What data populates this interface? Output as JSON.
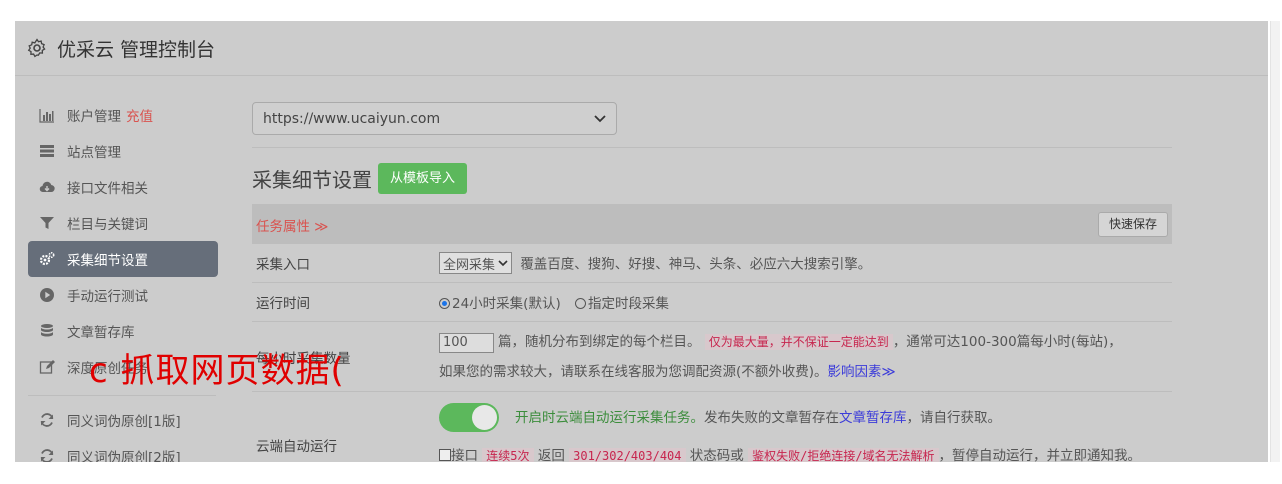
{
  "header": {
    "title": "优采云 管理控制台",
    "icon": "gear-icon"
  },
  "sidebar": {
    "items": [
      {
        "label": "账户管理",
        "extra": "充值",
        "icon": "bar-chart-icon"
      },
      {
        "label": "站点管理",
        "icon": "server-icon"
      },
      {
        "label": "接口文件相关",
        "icon": "cloud-download-icon"
      },
      {
        "label": "栏目与关键词",
        "icon": "filter-icon"
      },
      {
        "label": "采集细节设置",
        "icon": "cogs-icon",
        "active": true
      },
      {
        "label": "手动运行测试",
        "icon": "play-circle-icon"
      },
      {
        "label": "文章暂存库",
        "icon": "database-icon"
      },
      {
        "label": "深度原创任务",
        "icon": "edit-icon"
      },
      {
        "label": "同义词伪原创[1版]",
        "icon": "refresh-icon"
      },
      {
        "label": "同义词伪原创[2版]",
        "icon": "refresh-icon"
      }
    ]
  },
  "main": {
    "site_select": "https://www.ucaiyun.com",
    "section_title": "采集细节设置",
    "import_button": "从模板导入",
    "task_header": {
      "label": "任务属性 ≫",
      "save_button": "快速保存"
    },
    "rows": {
      "entry": {
        "label": "采集入口",
        "select": "全网采集",
        "desc": "覆盖百度、搜狗、好搜、神马、头条、必应六大搜索引擎。"
      },
      "time": {
        "label": "运行时间",
        "opt1": "24小时采集(默认)",
        "opt2": "指定时段采集"
      },
      "count": {
        "label": "每小时采集数量",
        "value": "100",
        "text1": "篇，随机分布到绑定的每个栏目。",
        "highlight": "仅为最大量，并不保证一定能达到",
        "text2": "，通常可达100-300篇每小时(每站)，",
        "text3": "如果您的需求较大，请联系在线客服为您调配资源(不额外收费)。",
        "link": "影响因素≫"
      },
      "cloud": {
        "label": "云端自动运行",
        "text1": "开启时云端自动运行采集任务。",
        "text2": "发布失败的文章暂存在",
        "link": "文章暂存库",
        "text3": "，请自行获取。",
        "cb_text1": "接口",
        "hl1": "连续5次",
        "cb_text2": "返回",
        "hl2": "301/302/403/404",
        "cb_text3": "状态码或",
        "hl3": "鉴权失败/拒绝连接/域名无法解析",
        "cb_text4": "，暂停自动运行，并立即通知我。"
      }
    }
  },
  "watermark": "c 抓取网页数据(",
  "colors": {
    "accent_green": "#5cb85c",
    "accent_red": "#d9534f",
    "active_nav": "#666e7a"
  }
}
